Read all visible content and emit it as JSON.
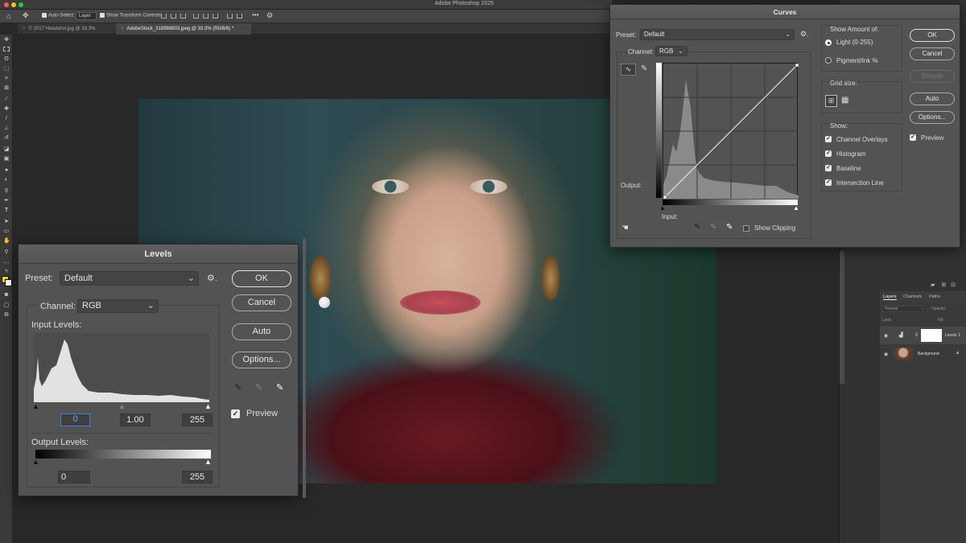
{
  "app": {
    "title": "Adobe Photoshop 2025",
    "traffic_colors": [
      "#ff5f57",
      "#febc2e",
      "#28c840"
    ]
  },
  "options_bar": {
    "auto_select_label": "Auto-Select:",
    "auto_select_value": "Layer",
    "transform_controls_label": "Show Transform Controls",
    "more_label": "•••"
  },
  "document_tabs": [
    {
      "label": "© 2017 Headshot.jpg @ 33.3% (RGB/8)",
      "active": false
    },
    {
      "label": "AdobeStock_318988803.jpeg @ 33.3% (RGB/8) *",
      "active": true
    }
  ],
  "tools": [
    "move-tool",
    "marquee-tool",
    "lasso-tool",
    "object-select-tool",
    "crop-tool",
    "frame-tool",
    "eyedropper-tool",
    "healing-brush-tool",
    "brush-tool",
    "clone-stamp-tool",
    "history-brush-tool",
    "eraser-tool",
    "gradient-tool",
    "blur-tool",
    "dodge-tool",
    "pen-tool",
    "type-tool",
    "path-select-tool",
    "rectangle-tool",
    "hand-tool",
    "zoom-tool"
  ],
  "colors": {
    "foreground": "#f0d838",
    "background": "#ffffff",
    "accent": "#3c7ee0"
  },
  "layers_panel": {
    "tabs": [
      "Layers",
      "Channels",
      "Paths"
    ],
    "blend_mode": "Normal",
    "opacity_label": "Opacity:",
    "lock_label": "Lock:",
    "fill_label": "Fill:",
    "layers": [
      {
        "name": "Levels 1",
        "selected": true
      },
      {
        "name": "Background",
        "selected": false
      }
    ]
  },
  "levels": {
    "title": "Levels",
    "preset_label": "Preset:",
    "preset_value": "Default",
    "channel_label": "Channel:",
    "channel_value": "RGB",
    "input_levels_label": "Input Levels:",
    "input_black": "0",
    "input_gamma": "1.00",
    "input_white": "255",
    "output_levels_label": "Output Levels:",
    "output_black": "0",
    "output_white": "255",
    "buttons": {
      "ok": "OK",
      "cancel": "Cancel",
      "auto": "Auto",
      "options": "Options..."
    },
    "preview_label": "Preview",
    "preview_checked": true
  },
  "curves": {
    "title": "Curves",
    "preset_label": "Preset:",
    "preset_value": "Default",
    "channel_label": "Channel:",
    "channel_value": "RGB",
    "output_label": "Output:",
    "input_label": "Input:",
    "show_clipping_label": "Show Clipping",
    "show_amount_label": "Show Amount of:",
    "light_label": "Light  (0-255)",
    "pigment_label": "Pigment/Ink %",
    "grid_size_label": "Grid size:",
    "show_label": "Show:",
    "show_options": [
      {
        "label": "Channel Overlays",
        "checked": true
      },
      {
        "label": "Histogram",
        "checked": true
      },
      {
        "label": "Baseline",
        "checked": true
      },
      {
        "label": "Intersection Line",
        "checked": true
      }
    ],
    "buttons": {
      "ok": "OK",
      "cancel": "Cancel",
      "smooth": "Smooth",
      "auto": "Auto",
      "options": "Options..."
    },
    "preview_label": "Preview",
    "preview_checked": true
  }
}
